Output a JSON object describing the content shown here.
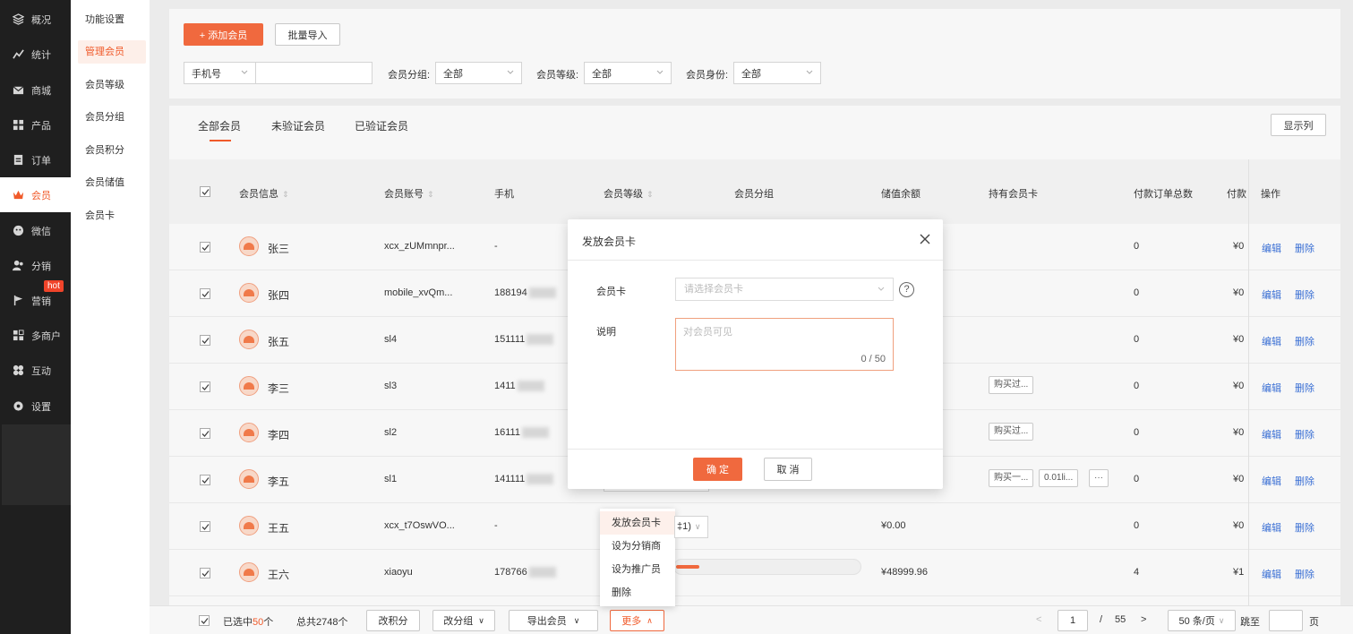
{
  "nav": {
    "items": [
      {
        "label": "概况",
        "icon": "layers-icon"
      },
      {
        "label": "统计",
        "icon": "chart-icon"
      },
      {
        "label": "商城",
        "icon": "mail-icon"
      },
      {
        "label": "产品",
        "icon": "grid-icon"
      },
      {
        "label": "订单",
        "icon": "clipboard-icon"
      },
      {
        "label": "会员",
        "icon": "crown-icon"
      },
      {
        "label": "微信",
        "icon": "wechat-icon"
      },
      {
        "label": "分销",
        "icon": "users-icon"
      },
      {
        "label": "营销",
        "icon": "flag-icon"
      },
      {
        "label": "多商户",
        "icon": "store-icon"
      },
      {
        "label": "互动",
        "icon": "interact-icon"
      },
      {
        "label": "设置",
        "icon": "gear-icon"
      }
    ],
    "hot_badge": "hot"
  },
  "subnav": {
    "items": [
      "功能设置",
      "管理会员",
      "会员等级",
      "会员分组",
      "会员积分",
      "会员储值",
      "会员卡"
    ]
  },
  "filter": {
    "add_button": "+ 添加会员",
    "import_button": "批量导入",
    "phone_select": "手机号",
    "group_label": "会员分组:",
    "group_value": "全部",
    "level_label": "会员等级:",
    "level_value": "全部",
    "identity_label": "会员身份:",
    "identity_value": "全部"
  },
  "tabs": [
    "全部会员",
    "未验证会员",
    "已验证会员"
  ],
  "display_columns_button": "显示列",
  "table": {
    "headers": {
      "info": "会员信息",
      "account": "会员账号",
      "phone": "手机",
      "level": "会员等级",
      "group": "会员分组",
      "balance": "储值余额",
      "cards": "持有会员卡",
      "orders": "付款订单总数",
      "paid": "付款",
      "ops": "操作"
    },
    "rows": [
      {
        "name": "张三",
        "account": "xcx_zUMmnpr...",
        "phone": "-",
        "balance": "",
        "cards": [],
        "orders": "0",
        "paid": "¥0"
      },
      {
        "name": "张四",
        "account": "mobile_xvQm...",
        "phone": "188194",
        "balance": "",
        "cards": [],
        "orders": "0",
        "paid": "¥0"
      },
      {
        "name": "张五",
        "account": "sl4",
        "phone": "151111",
        "balance": "",
        "cards": [],
        "orders": "0",
        "paid": "¥0"
      },
      {
        "name": "李三",
        "account": "sl3",
        "phone": "1411",
        "balance": "",
        "cards": [
          "购买过..."
        ],
        "orders": "0",
        "paid": "¥0"
      },
      {
        "name": "李四",
        "account": "sl2",
        "phone": "16111",
        "balance": "",
        "cards": [
          "购买过..."
        ],
        "orders": "0",
        "paid": "¥0"
      },
      {
        "name": "李五",
        "account": "sl1",
        "phone": "141111",
        "balance": "",
        "cards": [
          "购买一...",
          "0.01li...",
          "···"
        ],
        "orders": "0",
        "paid": "¥0"
      },
      {
        "name": "王五",
        "account": "xcx_t7OswVO...",
        "phone": "-",
        "balance": "¥0.00",
        "cards": [],
        "orders": "0",
        "paid": "¥0"
      },
      {
        "name": "王六",
        "account": "xiaoyu",
        "phone": "178766",
        "balance": "¥48999.96",
        "cards": [],
        "orders": "4",
        "paid": "¥1"
      }
    ],
    "edit_label": "编辑",
    "delete_label": "删除",
    "level_fragment": "‡1)"
  },
  "bottom": {
    "selected_prefix": "已选中",
    "selected_count": "50",
    "selected_suffix": "个",
    "total": "总共2748个",
    "change_points": "改积分",
    "change_group": "改分组",
    "export": "导出会员",
    "more": "更多",
    "page_current": "1",
    "page_sep": "/",
    "page_total": "55",
    "page_size": "50 条/页",
    "jump_label": "跳至",
    "page_unit": "页"
  },
  "dropdown": [
    "发放会员卡",
    "设为分销商",
    "设为推广员",
    "删除"
  ],
  "modal": {
    "title": "发放会员卡",
    "card_label": "会员卡",
    "card_placeholder": "请选择会员卡",
    "help": "?",
    "desc_label": "说明",
    "desc_placeholder": "对会员可见",
    "counter": "0 / 50",
    "confirm": "确 定",
    "cancel": "取 消"
  },
  "colors": {
    "accent": "#f05a2a",
    "link": "#3a6fd4",
    "nav_bg": "#1f1f1f"
  }
}
